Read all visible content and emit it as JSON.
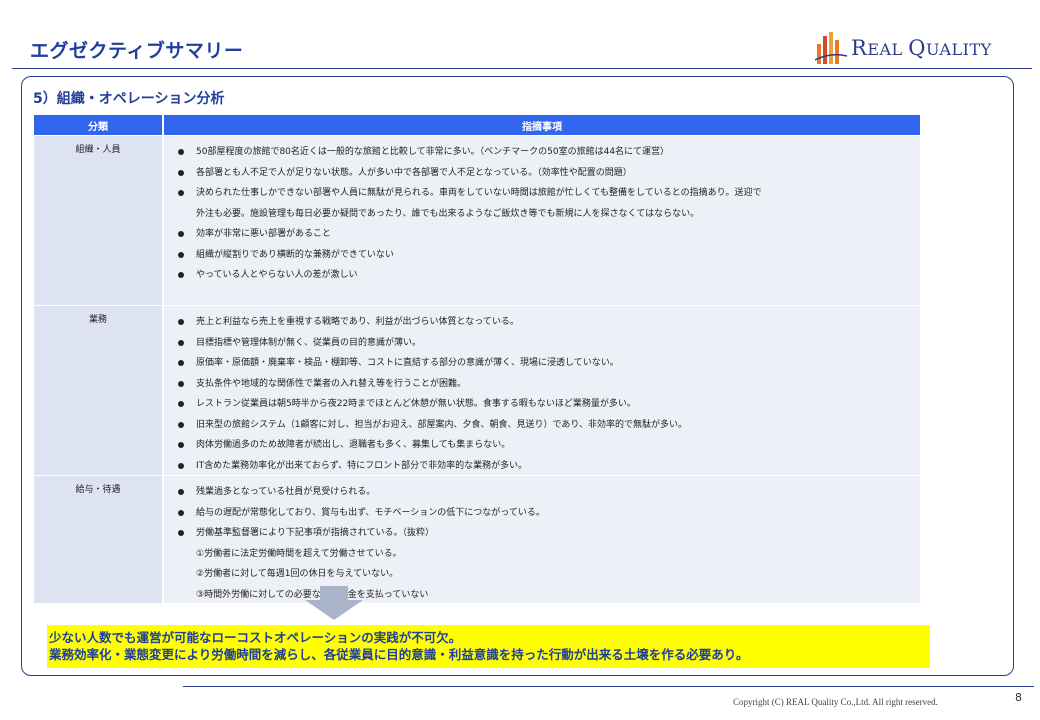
{
  "header": {
    "title": "エグゼクティブサマリー",
    "logo_text_1": "R",
    "logo_text_2": "EAL ",
    "logo_text_3": "Q",
    "logo_text_4": "UALITY"
  },
  "section": {
    "title": "5）組織・オペレーション分析"
  },
  "table": {
    "headers": [
      "分類",
      "指摘事項"
    ],
    "rows": [
      {
        "category": "組織・人員",
        "items": [
          "50部屋程度の旅館で80名近くは一般的な旅館と比較して非常に多い。（ベンチマークの50室の旅館は44名にて運営）",
          "各部署とも人不足で人が足りない状態。人が多い中で各部署で人不足となっている。（効率性や配置の問題）",
          "決められた仕事しかできない部署や人員に無駄が見られる。車両をしていない時間は旅館が忙しくても整備をしているとの指摘あり。送迎で",
          "外注も必要。施設管理も毎日必要か疑問であったり、誰でも出来るようなご飯炊き等でも新規に人を探さなくてはならない。",
          "効率が非常に悪い部署があること",
          "組織が縦割りであり横断的な兼務ができていない",
          "やっている人とやらない人の差が激しい"
        ]
      },
      {
        "category": "業務",
        "items": [
          "売上と利益なら売上を重視する戦略であり、利益が出づらい体質となっている。",
          "目標指標や管理体制が無く、従業員の目的意識が薄い。",
          "原価率・原価額・廃棄率・検品・棚卸等、コストに直結する部分の意識が薄く、現場に浸透していない。",
          "支払条件や地域的な関係性で業者の入れ替え等を行うことが困難。",
          "レストラン従業員は朝5時半から夜22時までほとんど休憩が無い状態。食事する暇もないほど業務量が多い。",
          "旧来型の旅館システム（1顧客に対し、担当がお迎え、部屋案内、夕食、朝食、見送り）であり、非効率的で無駄が多い。",
          "肉体労働過多のため故障者が続出し、退職者も多く、募集しても集まらない。",
          "IT含めた業務効率化が出来ておらず、特にフロント部分で非効率的な業務が多い。"
        ]
      },
      {
        "category": "給与・待遇",
        "items": [
          "残業過多となっている社員が見受けられる。",
          "給与の遅配が常態化しており、賞与も出ず、モチベーションの低下につながっている。",
          "労働基準監督署により下記事項が指摘されている。（抜粋）",
          "①労働者に法定労働時間を超えて労働させている。",
          "②労働者に対して毎週1回の休日を与えていない。",
          "③時間外労働に対しての必要な割増賃金を支払っていない"
        ]
      }
    ]
  },
  "conclusion": {
    "line1": "少ない人数でも運営が可能なローコストオペレーションの実践が不可欠。",
    "line2": "業務効率化・業態変更により労働時間を減らし、各従業員に目的意識・利益意識を持った行動が出来る土壌を作る必要あり。"
  },
  "footer": {
    "copyright": "Copyright (C) REAL Quality Co.,Ltd. All right reserved.",
    "page_number": "8"
  },
  "colors": {
    "brand_blue": "#1f3f9b",
    "header_blue": "#3366ee",
    "highlight_yellow": "#ffff00",
    "logo_orange": "#e8792b"
  }
}
